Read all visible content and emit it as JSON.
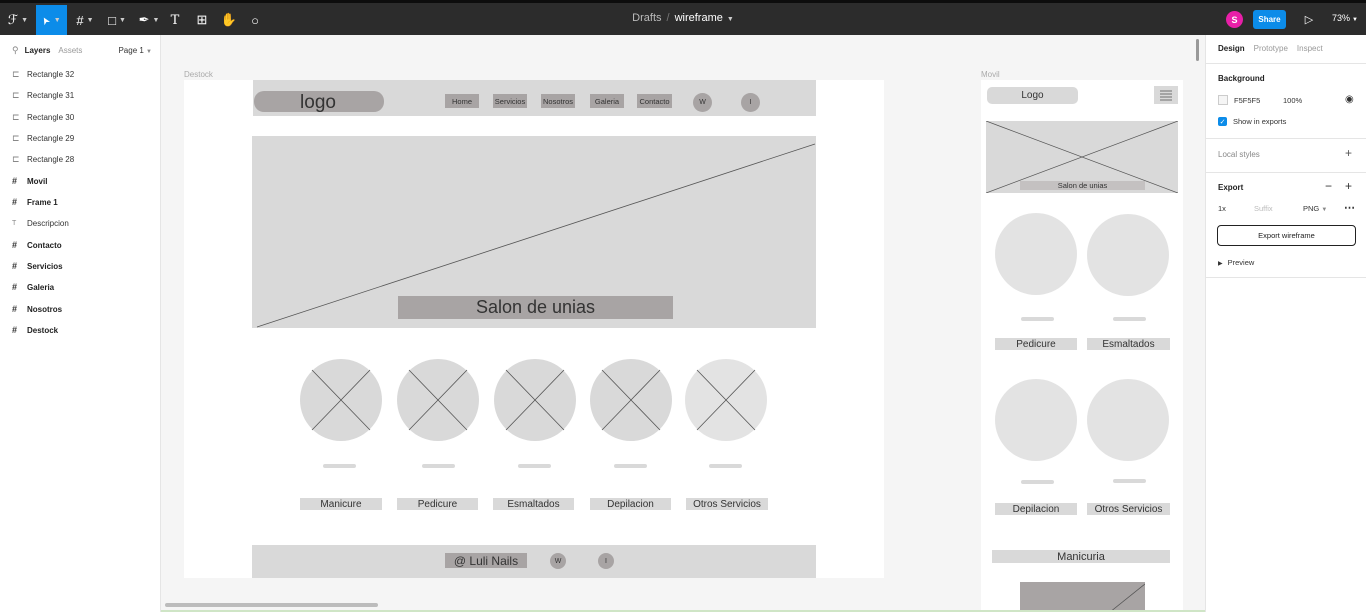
{
  "toolbar": {
    "tools": [
      {
        "name": "main-menu-icon",
        "glyph": "ℱ"
      },
      {
        "name": "move-tool-icon",
        "glyph": "➤"
      },
      {
        "name": "frame-tool-icon",
        "glyph": "#"
      },
      {
        "name": "shape-tool-icon",
        "glyph": "□"
      },
      {
        "name": "pen-tool-icon",
        "glyph": "✒"
      },
      {
        "name": "text-tool-icon",
        "glyph": "T"
      },
      {
        "name": "resources-icon",
        "glyph": "⊞"
      },
      {
        "name": "hand-tool-icon",
        "glyph": "✋"
      },
      {
        "name": "comment-tool-icon",
        "glyph": "○"
      }
    ],
    "breadcrumb_folder": "Drafts",
    "breadcrumb_sep": "/",
    "file_name": "wireframe",
    "avatar_initial": "S",
    "share_label": "Share",
    "play_glyph": "▷",
    "zoom": "73%"
  },
  "left_panel": {
    "tab_layers": "Layers",
    "tab_assets": "Assets",
    "page_selector": "Page 1",
    "layers": [
      {
        "label": "Rectangle 32",
        "type": "rect"
      },
      {
        "label": "Rectangle 31",
        "type": "rect"
      },
      {
        "label": "Rectangle 30",
        "type": "rect"
      },
      {
        "label": "Rectangle 29",
        "type": "rect"
      },
      {
        "label": "Rectangle 28",
        "type": "rect"
      },
      {
        "label": "Movil",
        "type": "frame"
      },
      {
        "label": "Frame 1",
        "type": "frame"
      },
      {
        "label": "Descripcion",
        "type": "text"
      },
      {
        "label": "Contacto",
        "type": "frame"
      },
      {
        "label": "Servicios",
        "type": "frame"
      },
      {
        "label": "Galeria",
        "type": "frame"
      },
      {
        "label": "Nosotros",
        "type": "frame"
      },
      {
        "label": "Destock",
        "type": "frame"
      }
    ]
  },
  "canvas": {
    "desk_label": "Destock",
    "mov_label": "Movil",
    "desk": {
      "logo": "logo",
      "nav": [
        "Home",
        "Servicios",
        "Nosotros",
        "Galeria",
        "Contacto"
      ],
      "nav_icons": [
        "W",
        "I"
      ],
      "hero_title": "Salon de unias",
      "services": [
        "Manicure",
        "Pedicure",
        "Esmaltados",
        "Depilacion",
        "Otros Servicios"
      ],
      "footer_handle": "@ Luli Nails",
      "footer_icons": [
        "W",
        "I"
      ]
    },
    "mov": {
      "logo": "Logo",
      "hero_title": "Salon de unias",
      "services": [
        "Pedicure",
        "Esmaltados",
        "Depilacion",
        "Otros Servicios"
      ],
      "section_title": "Manicuria"
    },
    "help": "?"
  },
  "right_panel": {
    "tabs": [
      "Design",
      "Prototype",
      "Inspect"
    ],
    "background_title": "Background",
    "bg_hex": "F5F5F5",
    "bg_opacity": "100%",
    "show_in_exports": "Show in exports",
    "local_styles": "Local styles",
    "export_title": "Export",
    "export_scale": "1x",
    "export_suffix_placeholder": "Suffix",
    "export_format": "PNG",
    "export_button": "Export wireframe",
    "preview": "Preview"
  },
  "colors": {
    "accent": "#0c8ce9",
    "toolbar_bg": "#2c2c2c",
    "wire_light": "#d9d9d9",
    "wire_dark": "#a8a4a4",
    "avatar": "#e81fa8"
  }
}
